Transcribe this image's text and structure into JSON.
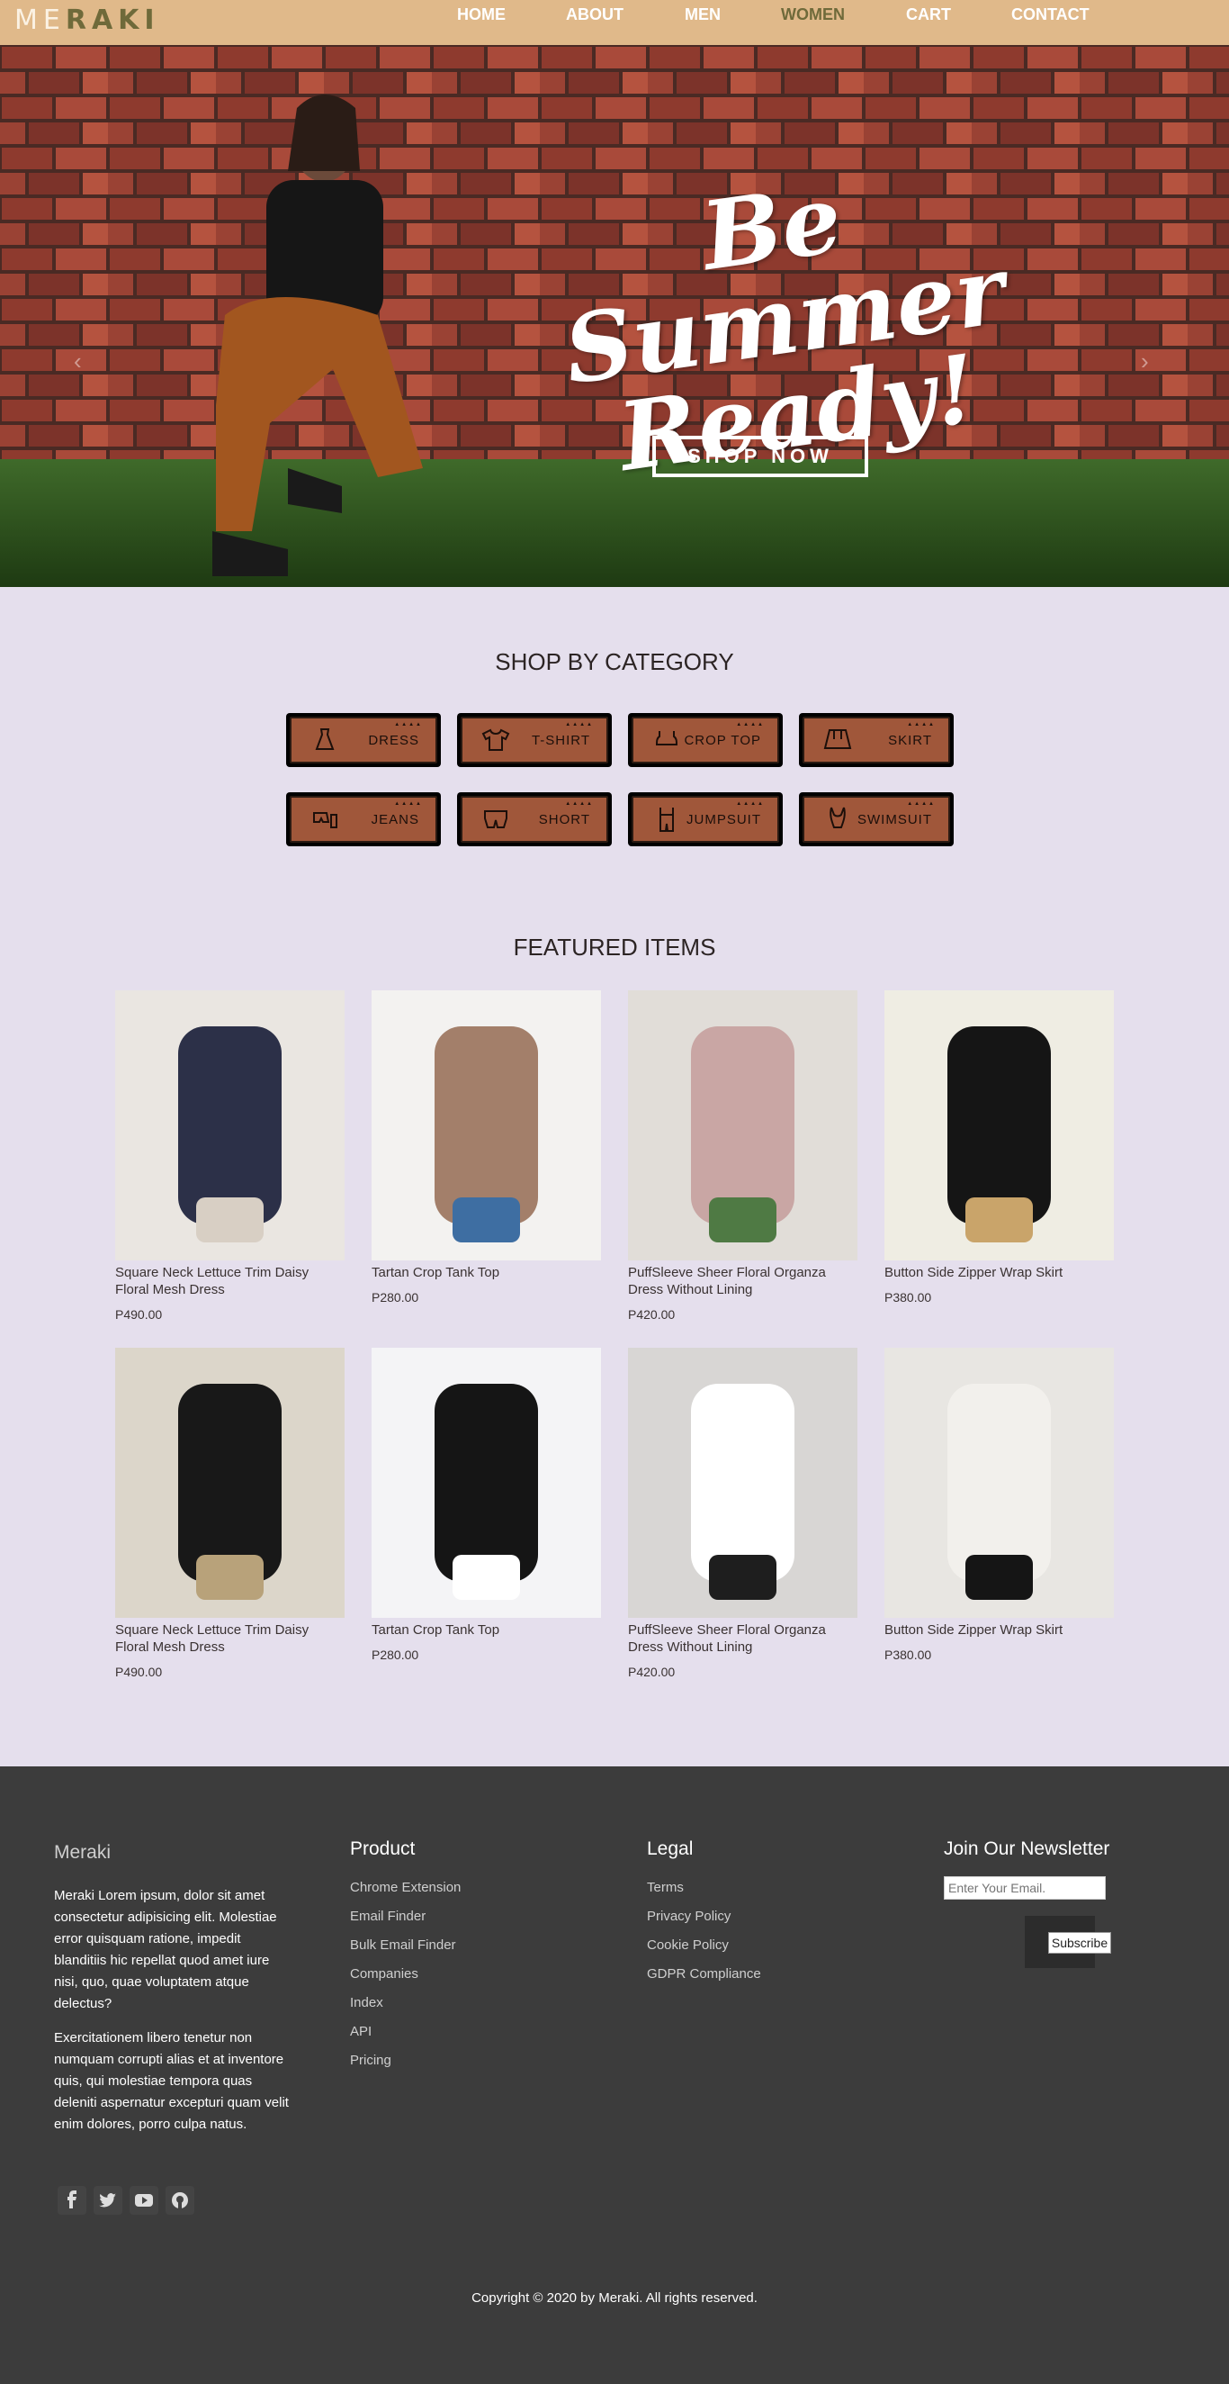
{
  "nav": {
    "logo_light": "ME",
    "logo_dark": "RAKI",
    "links": [
      "HOME",
      "ABOUT",
      "MEN",
      "WOMEN",
      "CART",
      "CONTACT"
    ],
    "active": "WOMEN"
  },
  "hero": {
    "title_line1": "Be Summer",
    "title_line2": "Ready!",
    "cta": "SHOP NOW",
    "prev_glyph": "‹",
    "next_glyph": "›",
    "slides": 2,
    "active_slide": 1
  },
  "categories": {
    "title": "SHOP BY CATEGORY",
    "items": [
      {
        "label": "DRESS",
        "icon": "dress-icon"
      },
      {
        "label": "T-SHIRT",
        "icon": "tshirt-icon"
      },
      {
        "label": "CROP TOP",
        "icon": "crop-top-icon"
      },
      {
        "label": "SKIRT",
        "icon": "skirt-icon"
      },
      {
        "label": "JEANS",
        "icon": "jeans-icon"
      },
      {
        "label": "SHORT",
        "icon": "short-icon"
      },
      {
        "label": "JUMPSUIT",
        "icon": "jumpsuit-icon"
      },
      {
        "label": "SWIMSUIT",
        "icon": "swimsuit-icon"
      }
    ]
  },
  "featured": {
    "title": "FEATURED ITEMS",
    "items": [
      {
        "name": "Square Neck Lettuce Trim Daisy Floral Mesh Dress",
        "price": "P490.00"
      },
      {
        "name": "Tartan Crop Tank Top",
        "price": "P280.00"
      },
      {
        "name": "PuffSleeve Sheer Floral Organza Dress Without Lining",
        "price": "P420.00"
      },
      {
        "name": "Button Side Zipper Wrap Skirt",
        "price": "P380.00"
      },
      {
        "name": "Square Neck Lettuce Trim Daisy Floral Mesh Dress",
        "price": "P490.00"
      },
      {
        "name": "Tartan Crop Tank Top",
        "price": "P280.00"
      },
      {
        "name": "PuffSleeve Sheer Floral Organza Dress Without Lining",
        "price": "P420.00"
      },
      {
        "name": "Button Side Zipper Wrap Skirt",
        "price": "P380.00"
      }
    ]
  },
  "footer": {
    "brand": "Meraki",
    "para1": "Meraki Lorem ipsum, dolor sit amet consectetur adipisicing elit. Molestiae error quisquam ratione, impedit blanditiis hic repellat quod amet iure nisi, quo, quae voluptatem atque delectus?",
    "para2": "Exercitationem libero tenetur non numquam corrupti alias et at inventore quis, qui molestiae tempora quas deleniti aspernatur excepturi quam velit enim dolores, porro culpa natus.",
    "product": {
      "heading": "Product",
      "links": [
        "Chrome Extension",
        "Email Finder",
        "Bulk Email Finder",
        "Companies",
        "Index",
        "API",
        "Pricing"
      ]
    },
    "legal": {
      "heading": "Legal",
      "links": [
        "Terms",
        "Privacy Policy",
        "Cookie Policy",
        "GDPR Compliance"
      ]
    },
    "newsletter": {
      "heading": "Join Our Newsletter",
      "placeholder": "Enter Your Email.",
      "button": "Subscribe"
    },
    "social": [
      "facebook-icon",
      "twitter-icon",
      "youtube-icon",
      "github-icon"
    ],
    "copyright": "Copyright © 2020 by Meraki. All rights reserved."
  },
  "colors": {
    "nav_bg": "#e0b98a",
    "page_bg": "#e5dfed",
    "category_button": "#a0573a",
    "footer_bg": "#3c3c3c"
  }
}
